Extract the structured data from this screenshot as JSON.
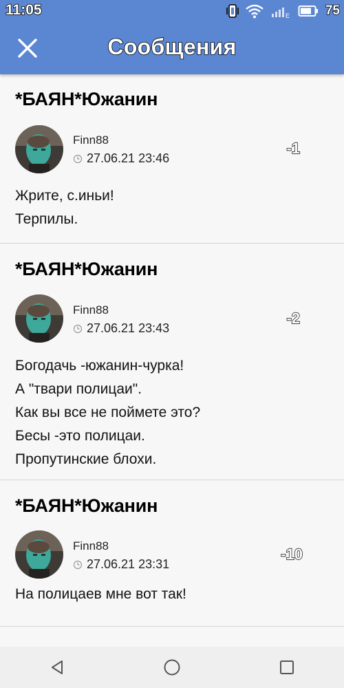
{
  "status_bar": {
    "time": "11:05",
    "network_label": "E",
    "battery": "75",
    "icons": [
      "vibrate-icon",
      "wifi-icon",
      "signal-icon",
      "battery-icon"
    ]
  },
  "app_bar": {
    "title": "Сообщения",
    "close_icon": "close-icon",
    "color": "#5b87d2"
  },
  "posts": [
    {
      "title": "*БАЯН*Южанин",
      "author": "Finn88",
      "date": "27.06.21 23:46",
      "score": "-1",
      "lines": [
        "Жрите, с.иньи!",
        "Терпилы."
      ]
    },
    {
      "title": "*БАЯН*Южанин",
      "author": "Finn88",
      "date": "27.06.21 23:43",
      "score": "-2",
      "lines": [
        "Богодачь -южанин-чурка!",
        "А \"твари полицаи\".",
        "Как вы все не поймете это?",
        "Бесы -это полицаи.",
        "Пропутинские блохи."
      ]
    },
    {
      "title": "*БАЯН*Южанин",
      "author": "Finn88",
      "date": "27.06.21 23:31",
      "score": "-10",
      "lines": [
        "На полицаев мне вот так!"
      ]
    }
  ],
  "nav_bar": {
    "buttons": [
      "back-icon",
      "home-icon",
      "recents-icon"
    ]
  }
}
